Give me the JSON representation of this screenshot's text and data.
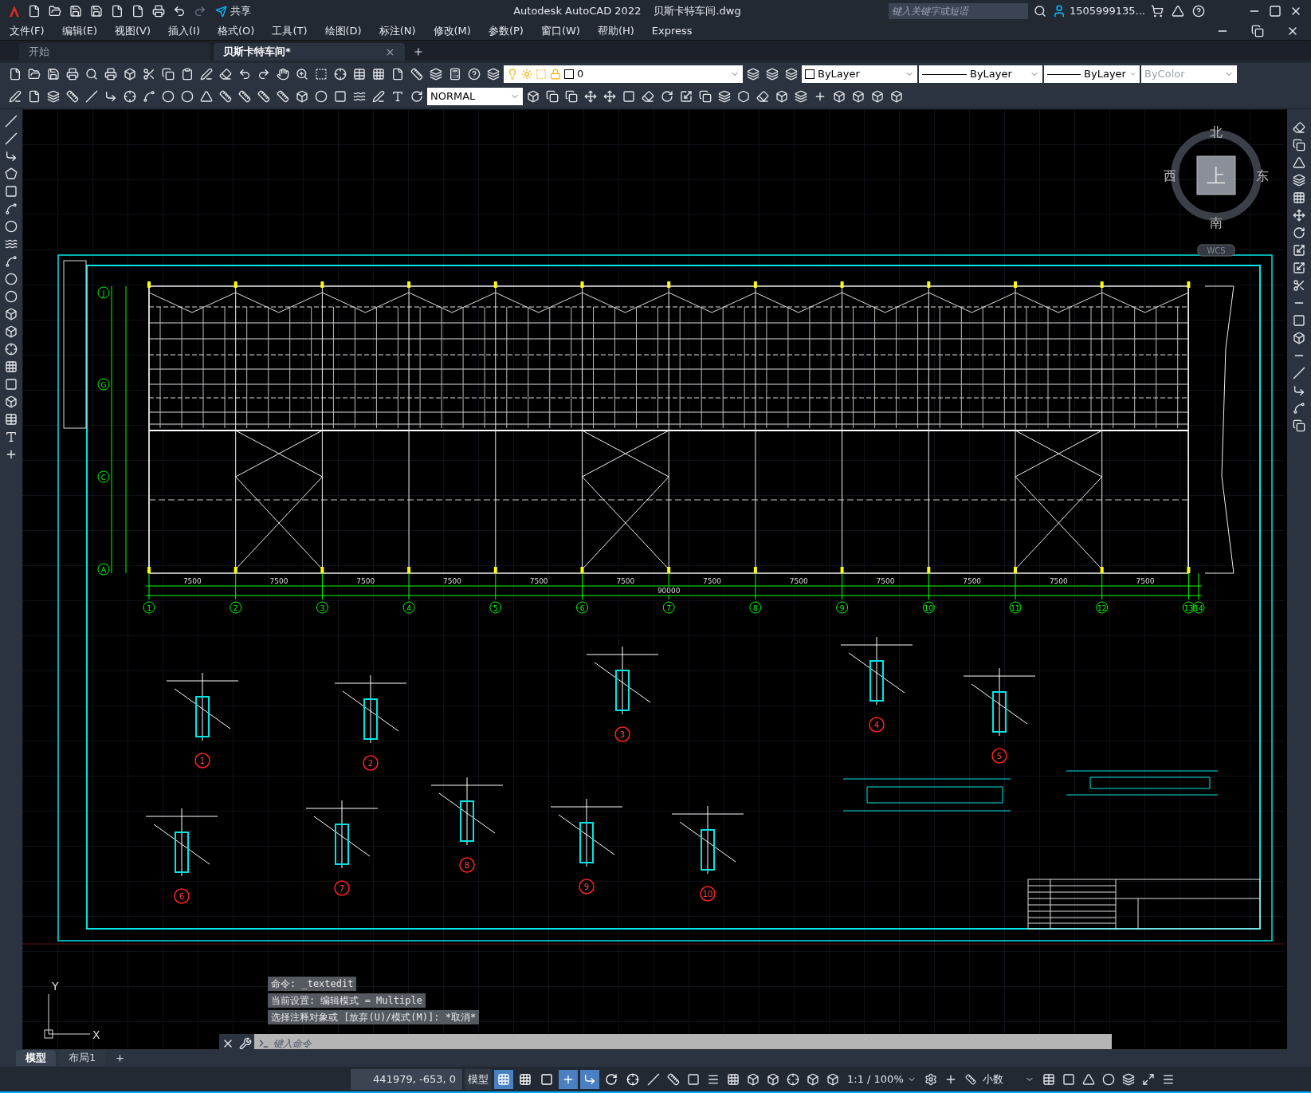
{
  "title_bar": {
    "share": "共享",
    "app_title": "Autodesk AutoCAD 2022",
    "file_name": "贝斯卡特车间.dwg",
    "search": {
      "placeholder": "键入关键字或短语"
    },
    "user": "1505999135..."
  },
  "menu": [
    "文件(F)",
    "编辑(E)",
    "视图(V)",
    "插入(I)",
    "格式(O)",
    "工具(T)",
    "绘图(D)",
    "标注(N)",
    "修改(M)",
    "参数(P)",
    "窗口(W)",
    "帮助(H)",
    "Express"
  ],
  "doc_tabs": [
    {
      "label": "开始",
      "selected": false
    },
    {
      "label": "贝斯卡特车间*",
      "selected": true
    }
  ],
  "properties": {
    "layer": "0",
    "text_style": "NORMAL",
    "color_control": "ByLayer",
    "linetype": "ByLayer",
    "lineweight": "ByLayer",
    "plot_style": "ByColor"
  },
  "viewcube": {
    "top": "上",
    "north": "北",
    "south": "南",
    "west": "西",
    "east": "东",
    "ucs": "WCS"
  },
  "drawing": {
    "column_axes": [
      "1",
      "2",
      "3",
      "4",
      "5",
      "6",
      "7",
      "8",
      "9",
      "10",
      "11",
      "12",
      "13",
      "14"
    ],
    "row_axes": [
      "J",
      "G",
      "C",
      "A"
    ],
    "bay_dims": [
      "7500",
      "7500",
      "7500",
      "7500",
      "7500",
      "7500",
      "7500",
      "7500",
      "7500",
      "7500",
      "7500",
      "7500"
    ],
    "total_dim": "90000",
    "details": [
      "1",
      "2",
      "3",
      "4",
      "5",
      "6",
      "7",
      "8",
      "9",
      "10"
    ]
  },
  "ucs_icon": {
    "x": "X",
    "y": "Y"
  },
  "command_history": [
    "命令: _textedit",
    "当前设置: 编辑模式 = Multiple",
    "选择注释对象或 [放弃(U)/模式(M)]: *取消*"
  ],
  "command_line": {
    "placeholder": "键入命令"
  },
  "layout_tabs": [
    {
      "label": "模型",
      "selected": true
    },
    {
      "label": "布局1",
      "selected": false
    }
  ],
  "status_bar": {
    "coordinates": "441979, -653, 0",
    "space": "模型",
    "scale": "1:1 / 100%",
    "units": "小数",
    "toggles": [
      {
        "kind": "grid",
        "on": true
      },
      {
        "kind": "snap",
        "on": false
      },
      {
        "kind": "infer",
        "on": false
      },
      {
        "kind": "dynamic",
        "on": true
      },
      {
        "kind": "ortho",
        "on": true
      },
      {
        "kind": "polar",
        "on": false
      },
      {
        "kind": "osnap",
        "on": false
      }
    ]
  }
}
